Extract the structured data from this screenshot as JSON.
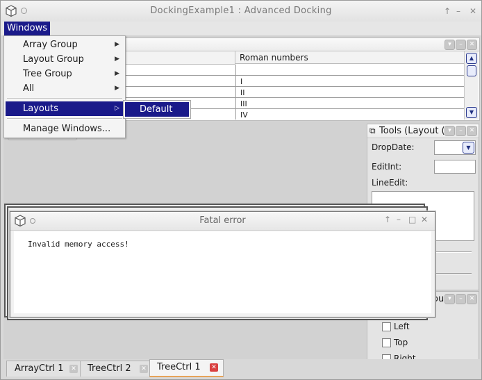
{
  "window": {
    "title": "DockingExample1 : Advanced Docking",
    "controls": {
      "pin": "↑",
      "minimize": "–",
      "close": "✕"
    }
  },
  "menubar": {
    "windows": "Windows"
  },
  "menu": {
    "items": [
      {
        "label": "Array Group",
        "submenu": true
      },
      {
        "label": "Layout Group",
        "submenu": true
      },
      {
        "label": "Tree Group",
        "submenu": true
      },
      {
        "label": "All",
        "submenu": true
      },
      {
        "label": "Layouts",
        "submenu": true,
        "highlighted": true
      },
      {
        "label": "Manage Windows...",
        "submenu": false
      }
    ],
    "layouts_submenu": [
      "Default"
    ]
  },
  "array_panel": {
    "columns": [
      "",
      "Roman numbers"
    ],
    "rows": [
      "",
      "I",
      "II",
      "III",
      "IV"
    ]
  },
  "tools_panel": {
    "title": "Tools (Layout (",
    "drop_date_label": "DropDate:",
    "drop_date_value": "",
    "edit_int_label": "EditInt:",
    "edit_int_value": "",
    "line_edit_label": "LineEdit:"
  },
  "align_panel": {
    "title_fragment": "ou",
    "options": [
      "Left",
      "Top",
      "Right"
    ]
  },
  "fatal_error": {
    "title": "Fatal error",
    "message": "Invalid memory access!"
  },
  "tabs": [
    {
      "label": "ArrayCtrl 1",
      "active": false
    },
    {
      "label": "TreeCtrl 2",
      "active": false
    },
    {
      "label": "TreeCtrl 1",
      "active": true
    }
  ],
  "colors": {
    "menu_highlight": "#1a1a8a",
    "active_tab_close": "#d94040",
    "active_tab_underline": "#e6a35a"
  }
}
